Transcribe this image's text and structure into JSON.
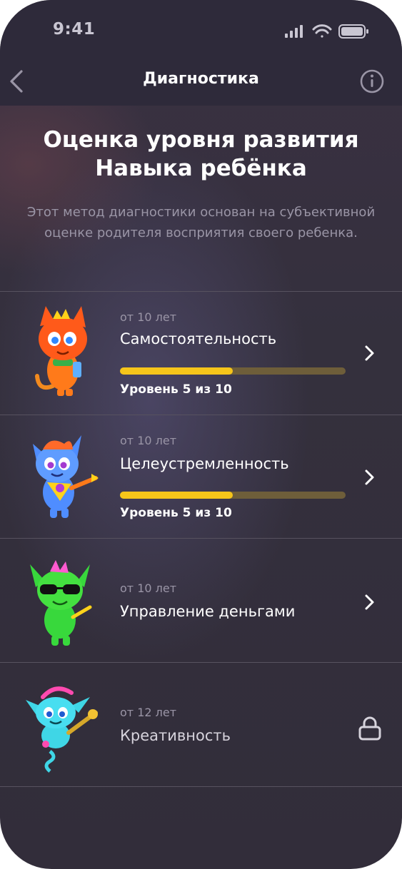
{
  "status_bar": {
    "time": "9:41"
  },
  "nav": {
    "title": "Диагностика"
  },
  "intro": {
    "heading_line1": "Оценка уровня развития",
    "heading_line2": "Навыка ребёнка",
    "description": "Этот метод диагностики основан на субъективной оценке родителя восприятия своего ребенка."
  },
  "skills": [
    {
      "age": "от 10 лет",
      "name": "Самостоятельность",
      "level_text": "Уровень 5 из 10",
      "level": 5,
      "max": 10,
      "locked": false
    },
    {
      "age": "от 10 лет",
      "name": "Целеустремленность",
      "level_text": "Уровень 5 из 10",
      "level": 5,
      "max": 10,
      "locked": false
    },
    {
      "age": "от 10 лет",
      "name": "Управление деньгами",
      "locked": false
    },
    {
      "age": "от 12 лет",
      "name": "Креативность",
      "locked": true
    }
  ],
  "colors": {
    "accent": "#f6c51a",
    "track": "#6e5e3a",
    "background": "#34303d"
  },
  "icons": [
    "back-arrow-icon",
    "info-icon",
    "chevron-right-icon",
    "lock-icon",
    "signal-icon",
    "wifi-icon",
    "battery-icon"
  ]
}
